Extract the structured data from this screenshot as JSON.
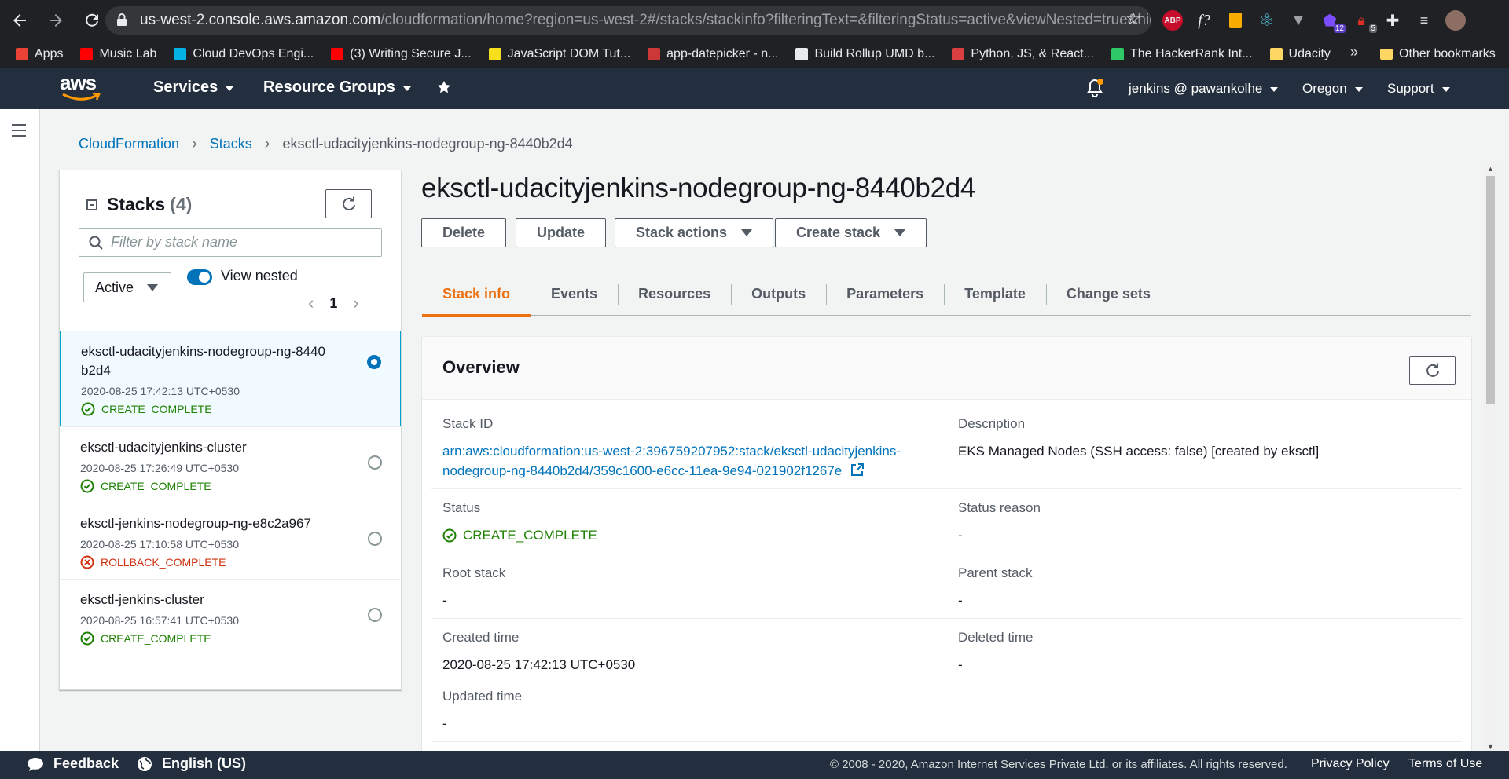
{
  "browser": {
    "url_host": "us-west-2.console.aws.amazon.com",
    "url_path": "/cloudformation/home?region=us-west-2#/stacks/stackinfo?filteringText=&filteringStatus=active&viewNested=true&hide...",
    "extensions": [
      "abp-icon",
      "formula-icon",
      "calculator-icon",
      "react-icon",
      "vue-icon",
      "puzzle-badge-icon",
      "lock-badge-icon",
      "extensions-icon",
      "media-icon",
      "profile-avatar"
    ],
    "ext_labels": {
      "abp": "ABP",
      "formula": "f?",
      "badge12": "12",
      "badge5": "5"
    },
    "bookmarks": [
      {
        "label": "Apps",
        "color": "#ea4335"
      },
      {
        "label": "Music Lab",
        "color": "#ff0000"
      },
      {
        "label": "Cloud DevOps Engi...",
        "color": "#02b3e4"
      },
      {
        "label": "(3) Writing Secure J...",
        "color": "#ff0000"
      },
      {
        "label": "JavaScript DOM Tut...",
        "color": "#f7df1e"
      },
      {
        "label": "app-datepicker - n...",
        "color": "#cb3837"
      },
      {
        "label": "Build Rollup UMD b...",
        "color": "#e8eaed"
      },
      {
        "label": "Python, JS, & React...",
        "color": "#d93f3f"
      },
      {
        "label": "The HackerRank Int...",
        "color": "#2ec866"
      },
      {
        "label": "Udacity",
        "color": "#fdd663"
      }
    ],
    "bookmarks_more": "»",
    "other_bookmarks": "Other bookmarks"
  },
  "awsnav": {
    "logo": "aws",
    "services": "Services",
    "resource_groups": "Resource Groups",
    "user": "jenkins @ pawankolhe",
    "region": "Oregon",
    "support": "Support"
  },
  "breadcrumb": [
    "CloudFormation",
    "Stacks",
    "eksctl-udacityjenkins-nodegroup-ng-8440b2d4"
  ],
  "stacks_panel": {
    "title": "Stacks",
    "count": "(4)",
    "search_placeholder": "Filter by stack name",
    "filter_value": "Active",
    "view_nested_label": "View nested",
    "view_nested_on": true,
    "page": "1",
    "items": [
      {
        "name": "eksctl-udacityjenkins-nodegroup-ng-8440b2d4",
        "name_display": "eksctl-udacityjenkins-nodegroup-ng-8440\nb2d4",
        "date": "2020-08-25 17:42:13 UTC+0530",
        "status": "CREATE_COMPLETE",
        "ok": true,
        "selected": true
      },
      {
        "name": "eksctl-udacityjenkins-cluster",
        "date": "2020-08-25 17:26:49 UTC+0530",
        "status": "CREATE_COMPLETE",
        "ok": true,
        "selected": false
      },
      {
        "name": "eksctl-jenkins-nodegroup-ng-e8c2a967",
        "date": "2020-08-25 17:10:58 UTC+0530",
        "status": "ROLLBACK_COMPLETE",
        "ok": false,
        "selected": false
      },
      {
        "name": "eksctl-jenkins-cluster",
        "date": "2020-08-25 16:57:41 UTC+0530",
        "status": "CREATE_COMPLETE",
        "ok": true,
        "selected": false
      }
    ]
  },
  "main": {
    "title": "eksctl-udacityjenkins-nodegroup-ng-8440b2d4",
    "buttons": {
      "delete": "Delete",
      "update": "Update",
      "stack_actions": "Stack actions",
      "create_stack": "Create stack"
    },
    "tabs": [
      "Stack info",
      "Events",
      "Resources",
      "Outputs",
      "Parameters",
      "Template",
      "Change sets"
    ],
    "active_tab": "Stack info",
    "overview": {
      "title": "Overview",
      "stack_id_label": "Stack ID",
      "stack_id_line1": "arn:aws:cloudformation:us-west-2:396759207952:stack/eksctl-udacityjenkins-",
      "stack_id_line2": "nodegroup-ng-8440b2d4/359c1600-e6cc-11ea-9e94-021902f1267e",
      "description_label": "Description",
      "description": "EKS Managed Nodes (SSH access: false) [created by eksctl]",
      "status_label": "Status",
      "status": "CREATE_COMPLETE",
      "status_reason_label": "Status reason",
      "status_reason": "-",
      "root_stack_label": "Root stack",
      "root_stack": "-",
      "parent_stack_label": "Parent stack",
      "parent_stack": "-",
      "created_label": "Created time",
      "created": "2020-08-25 17:42:13 UTC+0530",
      "deleted_label": "Deleted time",
      "deleted": "-",
      "updated_label": "Updated time",
      "updated": "-"
    }
  },
  "footer": {
    "feedback": "Feedback",
    "language": "English (US)",
    "copyright": "© 2008 - 2020, Amazon Internet Services Private Ltd. or its affiliates. All rights reserved.",
    "privacy": "Privacy Policy",
    "terms": "Terms of Use"
  },
  "colors": {
    "aws_nav": "#232f3e",
    "link": "#0073bb",
    "active_tab": "#ec7211",
    "success": "#1d8102",
    "error": "#d13212"
  }
}
